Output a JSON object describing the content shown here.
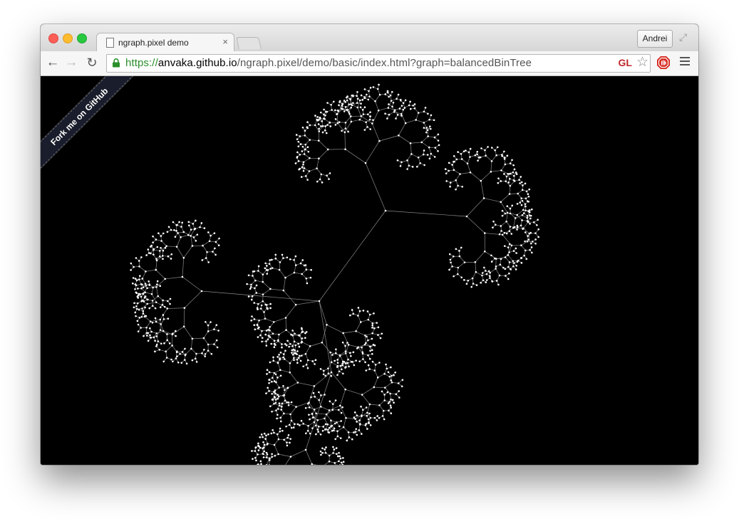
{
  "browser": {
    "tab": {
      "title": "ngraph.pixel demo",
      "close": "×"
    },
    "profile": {
      "name": "Andrei"
    },
    "nav": {
      "back": "←",
      "forward": "→",
      "reload": "↻"
    },
    "address": {
      "scheme": "https",
      "separator": "://",
      "host": "anvaka.github.io",
      "path": "/ngraph.pixel/demo/basic/index.html?graph=balancedBinTree"
    },
    "extension_badge": "GL",
    "bookmark_star": "☆"
  },
  "page": {
    "background": "#000000",
    "ribbon": {
      "label": "Fork me on GitHub",
      "color": "#1a1d2b"
    },
    "graph": {
      "name": "balancedBinTree",
      "node_color": "#ffffff",
      "edge_color": "#8a8a8a"
    }
  },
  "colors": {
    "secure_green": "#2a8f2a",
    "gl_red": "#c0282d",
    "close_red": "#fc5f57",
    "minimize_yellow": "#fdbc2e",
    "maximize_green": "#28c840"
  }
}
